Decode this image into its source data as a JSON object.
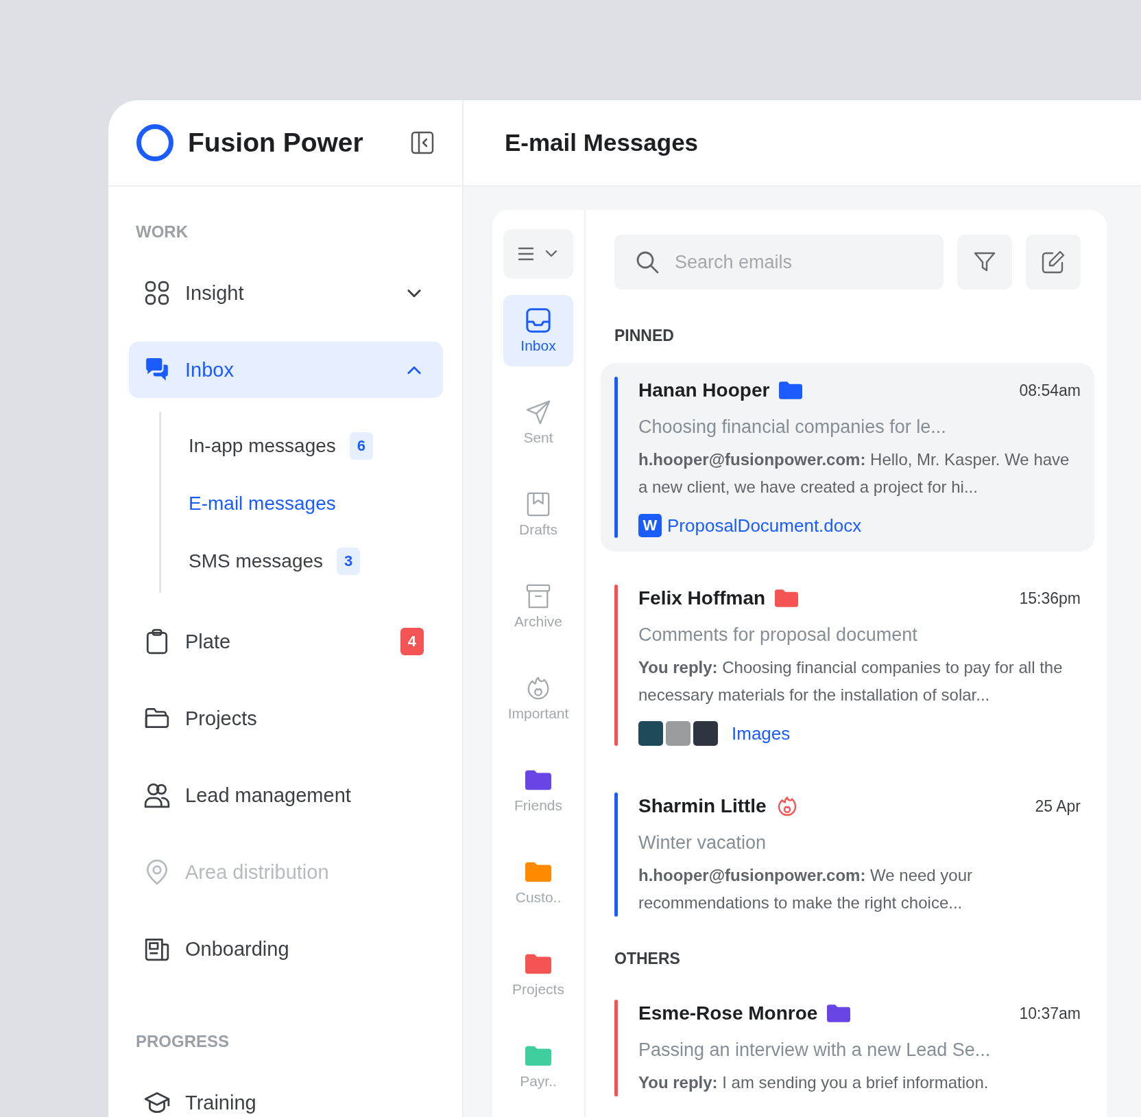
{
  "brand": {
    "name": "Fusion Power"
  },
  "page_title": "E-mail Messages",
  "sidebar": {
    "sections": [
      {
        "heading": "WORK",
        "items": [
          {
            "label": "Insight",
            "kind": "group",
            "expanded": false,
            "selected": false,
            "disabled": false
          },
          {
            "label": "Inbox",
            "kind": "group",
            "expanded": true,
            "selected": true,
            "disabled": false,
            "children": [
              {
                "label": "In-app messages",
                "badge": "6",
                "selected": false
              },
              {
                "label": "E-mail messages",
                "selected": true
              },
              {
                "label": "SMS messages",
                "badge": "3",
                "selected": false
              }
            ]
          },
          {
            "label": "Plate",
            "kind": "link",
            "selected": false,
            "disabled": false,
            "badge": "4"
          },
          {
            "label": "Projects",
            "kind": "link",
            "selected": false,
            "disabled": false
          },
          {
            "label": "Lead management",
            "kind": "link",
            "selected": false,
            "disabled": false
          },
          {
            "label": "Area distribution",
            "kind": "link",
            "selected": false,
            "disabled": true
          },
          {
            "label": "Onboarding",
            "kind": "link",
            "selected": false,
            "disabled": false
          }
        ]
      },
      {
        "heading": "PROGRESS",
        "items": [
          {
            "label": "Training",
            "kind": "link",
            "selected": false,
            "disabled": false
          }
        ]
      }
    ]
  },
  "mail_folders": [
    {
      "label": "Inbox",
      "kind": "view",
      "selected": true
    },
    {
      "label": "Sent",
      "kind": "view",
      "selected": false
    },
    {
      "label": "Drafts",
      "kind": "view",
      "selected": false
    },
    {
      "label": "Archive",
      "kind": "view",
      "selected": false
    },
    {
      "label": "Important",
      "kind": "view",
      "selected": false
    },
    {
      "label": "Friends",
      "kind": "folder",
      "color": "#6a45e6",
      "selected": false
    },
    {
      "label": "Custo..",
      "kind": "folder",
      "color": "#ff8a00",
      "selected": false
    },
    {
      "label": "Projects",
      "kind": "folder",
      "color": "#f45454",
      "selected": false
    },
    {
      "label": "Payr..",
      "kind": "folder",
      "color": "#3fcf9f",
      "selected": false
    }
  ],
  "search": {
    "placeholder": "Search emails"
  },
  "groups": [
    {
      "heading": "PINNED",
      "emails": [
        {
          "sender": "Hanan Hooper",
          "tag": {
            "kind": "folder",
            "color": "#1a5cff"
          },
          "time": "08:54am",
          "subject": "Choosing financial companies for le...",
          "preview": "**h.hooper@fusionpower.com:** Hello, Mr. Kasper.  We have a new client, we have created a project for hi...",
          "color": "#1a5cff",
          "selected": true,
          "attachment": {
            "kind": "file",
            "letter": "W",
            "name": "ProposalDocument.docx"
          }
        },
        {
          "sender": "Felix Hoffman",
          "tag": {
            "kind": "folder",
            "color": "#f45454"
          },
          "time": "15:36pm",
          "subject": "Comments for proposal document",
          "preview": "**You reply:** Choosing financial companies to pay for all the necessary materials for the installation of solar...",
          "color": "#f45454",
          "selected": false,
          "attachment": {
            "kind": "images",
            "name": "Images"
          }
        },
        {
          "sender": "Sharmin Little",
          "tag": {
            "kind": "important"
          },
          "time": "25 Apr",
          "subject": "Winter vacation",
          "preview": "**h.hooper@fusionpower.com:** We need your recommendations to make the right choice...",
          "color": "#1a5cff",
          "selected": false
        }
      ]
    },
    {
      "heading": "OTHERS",
      "emails": [
        {
          "sender": "Esme-Rose Monroe",
          "tag": {
            "kind": "folder",
            "color": "#6a45e6"
          },
          "time": "10:37am",
          "subject": "Passing an interview with a new Lead Se...",
          "preview": "**You reply:** I am sending you a brief information.",
          "color": "#f45454",
          "selected": false
        }
      ]
    }
  ]
}
